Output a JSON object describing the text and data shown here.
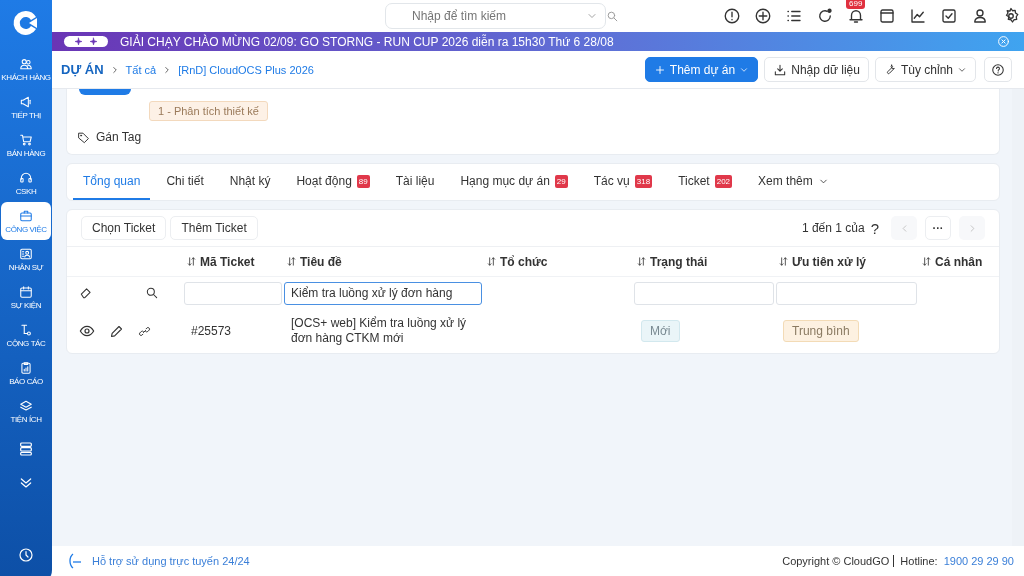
{
  "sidebar": {
    "items": [
      {
        "label": "KHÁCH HÀNG",
        "selected": false
      },
      {
        "label": "TIẾP THỊ",
        "selected": false
      },
      {
        "label": "BÁN HÀNG",
        "selected": false
      },
      {
        "label": "CSKH",
        "selected": false
      },
      {
        "label": "CÔNG VIỆC",
        "selected": true
      },
      {
        "label": "NHÂN SỰ",
        "selected": false
      },
      {
        "label": "SỰ KIỆN",
        "selected": false
      },
      {
        "label": "CỘNG TÁC",
        "selected": false
      },
      {
        "label": "BÁO CÁO",
        "selected": false
      },
      {
        "label": "TIỆN ÍCH",
        "selected": false
      }
    ]
  },
  "header": {
    "search": {
      "placeholder": "Nhập để tìm kiếm"
    },
    "notification_count": "699"
  },
  "banner": {
    "text": "GIẢI CHẠY CHÀO MỪNG 02/09: GO STORNG - RUN CUP 2026 diễn ra 15h30 Thứ 6 28/08"
  },
  "breadcrumb": {
    "title": "DỰ ÁN",
    "crumbs": [
      "Tất cả",
      "[RnD] CloudOCS Plus 2026"
    ]
  },
  "actions": [
    {
      "label": "Thêm dự án",
      "kind": "primary"
    },
    {
      "label": "Nhập dữ liệu",
      "kind": "default"
    },
    {
      "label": "Tùy chỉnh",
      "kind": "default"
    }
  ],
  "project": {
    "stage": "1 - Phân tích thiết kế",
    "tag_action": "Gán Tag"
  },
  "tabs": [
    {
      "label": "Tổng quan",
      "selected": true
    },
    {
      "label": "Chi tiết",
      "selected": false
    },
    {
      "label": "Nhật ký",
      "selected": false
    },
    {
      "label": "Hoạt động",
      "count": "89",
      "selected": false
    },
    {
      "label": "Tài liệu",
      "selected": false
    },
    {
      "label": "Hạng mục dự án",
      "count": "29",
      "selected": false
    },
    {
      "label": "Tác vụ",
      "count": "318",
      "selected": false
    },
    {
      "label": "Ticket",
      "count": "202",
      "selected": false
    }
  ],
  "more_tab": "Xem thêm",
  "table": {
    "buttons": [
      "Chọn Ticket",
      "Thêm Ticket"
    ],
    "pagination": {
      "range": "1 đến 1 của",
      "total": "?",
      "more": "···"
    },
    "columns": [
      {
        "label": "Mã Ticket",
        "filter": true
      },
      {
        "label": "Tiêu đề",
        "filter": true,
        "value": "Kiểm tra luồng xử lý đơn hàng"
      },
      {
        "label": "Tổ chức",
        "filter": false
      },
      {
        "label": "Trạng thái",
        "filter": true
      },
      {
        "label": "Ưu tiên xử lý",
        "filter": true
      },
      {
        "label": "Cá nhân",
        "filter": false
      }
    ],
    "rows": [
      {
        "ticket": "#25573",
        "title": "[OCS+ web] Kiểm tra luồng xử lý đơn hàng CTKM mới",
        "status": "Mới",
        "priority": "Trung bình"
      }
    ]
  },
  "footer": {
    "support": "Hỗ trợ sử dụng trực tuyến 24/24",
    "copyright": "Copyright © CloudGO",
    "hotline_label": "Hotline:",
    "hotline": "1900 29 29 90"
  }
}
